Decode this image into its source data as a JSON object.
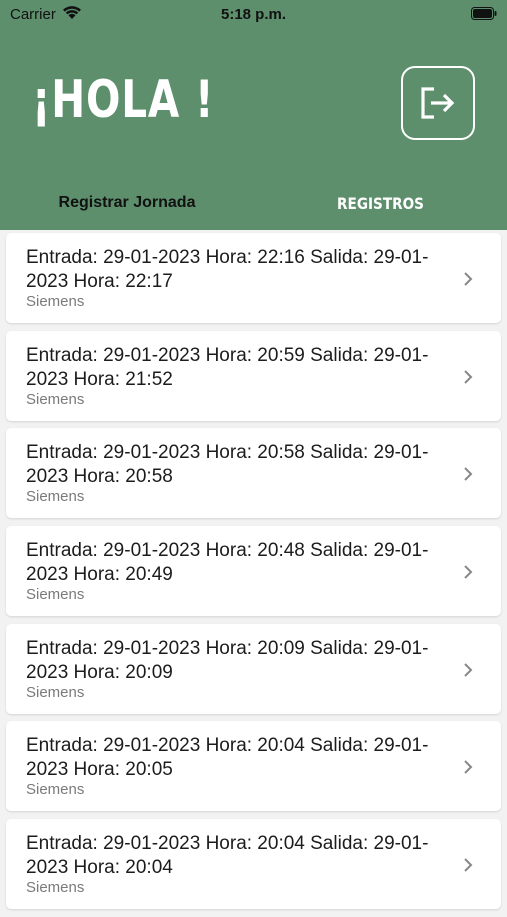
{
  "status_bar": {
    "carrier": "Carrier",
    "time": "5:18 p.m."
  },
  "header": {
    "title": "¡HOLA !",
    "logout_icon": "logout-icon",
    "background_color": "#5d8f6d"
  },
  "tabs": [
    {
      "label": "Registrar Jornada",
      "selected": true
    },
    {
      "label": "REGISTROS",
      "selected": false
    }
  ],
  "records": [
    {
      "title": "Entrada: 29-01-2023 Hora: 22:16 Salida: 29-01-2023 Hora: 22:17",
      "company": "Siemens"
    },
    {
      "title": "Entrada: 29-01-2023 Hora: 20:59 Salida: 29-01-2023 Hora: 21:52",
      "company": "Siemens"
    },
    {
      "title": "Entrada: 29-01-2023 Hora: 20:58 Salida: 29-01-2023 Hora: 20:58",
      "company": "Siemens"
    },
    {
      "title": "Entrada: 29-01-2023 Hora: 20:48 Salida: 29-01-2023 Hora: 20:49",
      "company": "Siemens"
    },
    {
      "title": "Entrada: 29-01-2023 Hora: 20:09 Salida: 29-01-2023 Hora: 20:09",
      "company": "Siemens"
    },
    {
      "title": "Entrada: 29-01-2023 Hora: 20:04 Salida: 29-01-2023 Hora: 20:05",
      "company": "Siemens"
    },
    {
      "title": "Entrada: 29-01-2023 Hora: 20:04 Salida: 29-01-2023 Hora: 20:04",
      "company": "Siemens"
    }
  ]
}
